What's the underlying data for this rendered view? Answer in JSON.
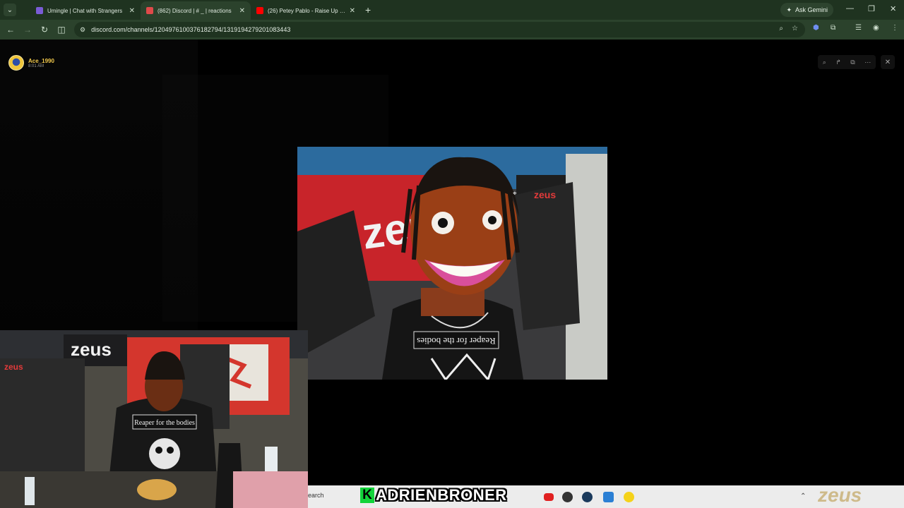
{
  "browser": {
    "tabs": [
      {
        "title": "Umingle | Chat with Strangers",
        "favicon_color": "#7a5cd6",
        "active": false
      },
      {
        "title": "(862) Discord | # _ | reactions",
        "favicon_color": "#e04a4a",
        "active": true
      },
      {
        "title": "(26) Petey Pablo - Raise Up (Of",
        "favicon_color": "#ff0000",
        "active": false
      }
    ],
    "ask_gemini_label": "Ask Gemini",
    "url": "discord.com/channels/1204976100376182794/1319194279201083443"
  },
  "viewer": {
    "uploader_name": "Ace_1990",
    "upload_time": "8:01 AM"
  },
  "taskbar": {
    "search_text": "earch"
  },
  "overlay": {
    "streamer_initial": "K",
    "streamer_name": "ADRIENBRONER"
  },
  "main_image": {
    "shirt_text": "Reaper for the bodies",
    "chair_brand": "zeus"
  },
  "webcam": {
    "shirt_text": "Reaper for the bodies",
    "banner_text": "zeus"
  },
  "colors": {
    "browser_frame": "#1f3320",
    "browser_toolbar": "#2b422c",
    "uploader_name": "#f2c94c",
    "overlay_green": "#12d43a"
  }
}
